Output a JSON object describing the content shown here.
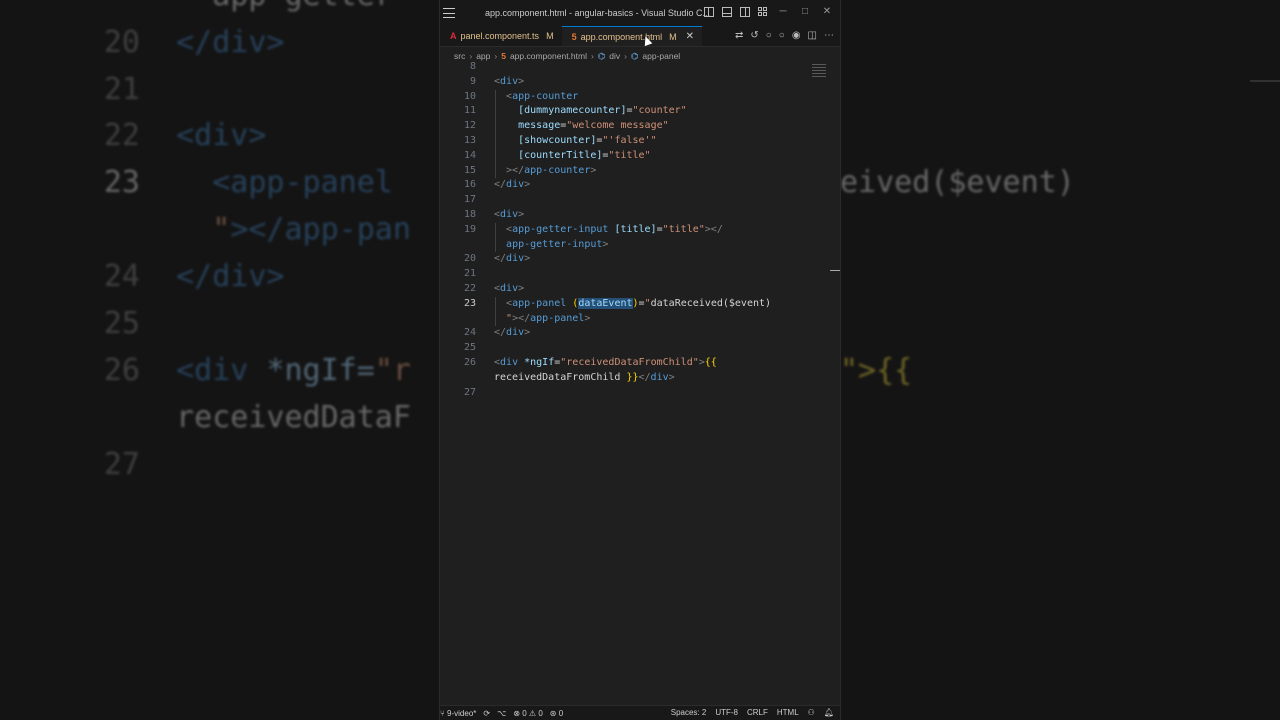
{
  "background": {
    "lines": [
      {
        "num": "",
        "segments": [
          {
            "cls": "bg-txt",
            "text": "  app-getter-"
          }
        ]
      },
      {
        "num": "20",
        "segments": [
          {
            "cls": "bg-tag",
            "text": "</div>"
          }
        ]
      },
      {
        "num": "21",
        "segments": []
      },
      {
        "num": "22",
        "segments": [
          {
            "cls": "bg-tag",
            "text": "<div>"
          }
        ]
      },
      {
        "num": "23",
        "segments": [
          {
            "cls": "bg-tag",
            "text": "  <app-panel"
          }
        ]
      },
      {
        "num": "",
        "segments": [
          {
            "cls": "bg-str",
            "text": "  \""
          },
          {
            "cls": "bg-tag",
            "text": "></app-pan"
          }
        ]
      },
      {
        "num": "24",
        "segments": [
          {
            "cls": "bg-tag",
            "text": "</div>"
          }
        ]
      },
      {
        "num": "25",
        "segments": []
      },
      {
        "num": "26",
        "segments": [
          {
            "cls": "bg-tag",
            "text": "<div "
          },
          {
            "cls": "bg-attr",
            "text": "*ngIf="
          },
          {
            "cls": "bg-str",
            "text": "\"r"
          }
        ]
      },
      {
        "num": "",
        "segments": [
          {
            "cls": "bg-txt",
            "text": "receivedDataF"
          }
        ]
      },
      {
        "num": "27",
        "segments": []
      }
    ],
    "right_fragments": [
      {
        "text": "eived($event)"
      },
      {
        "text": "\">{{"
      }
    ]
  },
  "window": {
    "title": "app.component.html - angular-basics - Visual Studio C...",
    "controls": {
      "minimize": "─",
      "maximize": "□",
      "close": "✕"
    }
  },
  "tabs": [
    {
      "label": "panel.component.ts",
      "modified": "M",
      "icon": "angular-icon",
      "active": false
    },
    {
      "label": "app.component.html",
      "modified": "M",
      "icon": "html-icon",
      "active": true,
      "close": "✕"
    }
  ],
  "breadcrumb": {
    "items": [
      "src",
      "app",
      "app.component.html",
      "div",
      "app-panel"
    ]
  },
  "editor": {
    "current_line": "23",
    "lines": [
      {
        "num": "8",
        "tokens": []
      },
      {
        "num": "9",
        "tokens": [
          {
            "c": "t-br",
            "t": "<"
          },
          {
            "c": "t-tag",
            "t": "div"
          },
          {
            "c": "t-br",
            "t": ">"
          }
        ]
      },
      {
        "num": "10",
        "tokens": [
          {
            "c": "t-txt",
            "t": "  "
          },
          {
            "c": "t-br",
            "t": "<"
          },
          {
            "c": "t-tag",
            "t": "app-counter"
          }
        ]
      },
      {
        "num": "11",
        "tokens": [
          {
            "c": "t-txt",
            "t": "    "
          },
          {
            "c": "t-attr",
            "t": "[dummynamecounter]"
          },
          {
            "c": "t-txt",
            "t": "="
          },
          {
            "c": "t-str",
            "t": "\"counter\""
          }
        ]
      },
      {
        "num": "12",
        "tokens": [
          {
            "c": "t-txt",
            "t": "    "
          },
          {
            "c": "t-attr",
            "t": "message"
          },
          {
            "c": "t-txt",
            "t": "="
          },
          {
            "c": "t-str",
            "t": "\"welcome message\""
          }
        ]
      },
      {
        "num": "13",
        "tokens": [
          {
            "c": "t-txt",
            "t": "    "
          },
          {
            "c": "t-attr",
            "t": "[showcounter]"
          },
          {
            "c": "t-txt",
            "t": "="
          },
          {
            "c": "t-str",
            "t": "\"'false'\""
          }
        ]
      },
      {
        "num": "14",
        "tokens": [
          {
            "c": "t-txt",
            "t": "    "
          },
          {
            "c": "t-attr",
            "t": "[counterTitle]"
          },
          {
            "c": "t-txt",
            "t": "="
          },
          {
            "c": "t-str",
            "t": "\"title\""
          }
        ]
      },
      {
        "num": "15",
        "tokens": [
          {
            "c": "t-txt",
            "t": "  "
          },
          {
            "c": "t-br",
            "t": "></"
          },
          {
            "c": "t-tag",
            "t": "app-counter"
          },
          {
            "c": "t-br",
            "t": ">"
          }
        ]
      },
      {
        "num": "16",
        "tokens": [
          {
            "c": "t-br",
            "t": "</"
          },
          {
            "c": "t-tag",
            "t": "div"
          },
          {
            "c": "t-br",
            "t": ">"
          }
        ]
      },
      {
        "num": "17",
        "tokens": []
      },
      {
        "num": "18",
        "tokens": [
          {
            "c": "t-br",
            "t": "<"
          },
          {
            "c": "t-tag",
            "t": "div"
          },
          {
            "c": "t-br",
            "t": ">"
          }
        ]
      },
      {
        "num": "19",
        "tokens": [
          {
            "c": "t-txt",
            "t": "  "
          },
          {
            "c": "t-br",
            "t": "<"
          },
          {
            "c": "t-tag",
            "t": "app-getter-input"
          },
          {
            "c": "t-txt",
            "t": " "
          },
          {
            "c": "t-attr",
            "t": "[title]"
          },
          {
            "c": "t-txt",
            "t": "="
          },
          {
            "c": "t-str",
            "t": "\"title\""
          },
          {
            "c": "t-br",
            "t": "></"
          }
        ]
      },
      {
        "num": "",
        "tokens": [
          {
            "c": "t-txt",
            "t": "  "
          },
          {
            "c": "t-tag",
            "t": "app-getter-input"
          },
          {
            "c": "t-br",
            "t": ">"
          }
        ]
      },
      {
        "num": "20",
        "tokens": [
          {
            "c": "t-br",
            "t": "</"
          },
          {
            "c": "t-tag",
            "t": "div"
          },
          {
            "c": "t-br",
            "t": ">"
          }
        ]
      },
      {
        "num": "21",
        "tokens": []
      },
      {
        "num": "22",
        "tokens": [
          {
            "c": "t-br",
            "t": "<"
          },
          {
            "c": "t-tag",
            "t": "div"
          },
          {
            "c": "t-br",
            "t": ">"
          }
        ]
      },
      {
        "num": "23",
        "tokens": [
          {
            "c": "t-txt",
            "t": "  "
          },
          {
            "c": "t-br",
            "t": "<"
          },
          {
            "c": "t-tag",
            "t": "app-panel"
          },
          {
            "c": "t-txt",
            "t": " "
          },
          {
            "c": "t-yel",
            "t": "("
          },
          {
            "c": "t-sel",
            "t": "dataEvent"
          },
          {
            "c": "t-yel",
            "t": ")"
          },
          {
            "c": "t-txt",
            "t": "="
          },
          {
            "c": "t-str",
            "t": "\""
          },
          {
            "c": "t-txt",
            "t": "dataReceived($event)"
          }
        ]
      },
      {
        "num": "",
        "tokens": [
          {
            "c": "t-txt",
            "t": "  "
          },
          {
            "c": "t-str",
            "t": "\""
          },
          {
            "c": "t-br",
            "t": "></"
          },
          {
            "c": "t-tag",
            "t": "app-panel"
          },
          {
            "c": "t-br",
            "t": ">"
          }
        ]
      },
      {
        "num": "24",
        "tokens": [
          {
            "c": "t-br",
            "t": "</"
          },
          {
            "c": "t-tag",
            "t": "div"
          },
          {
            "c": "t-br",
            "t": ">"
          }
        ]
      },
      {
        "num": "25",
        "tokens": []
      },
      {
        "num": "26",
        "tokens": [
          {
            "c": "t-br",
            "t": "<"
          },
          {
            "c": "t-tag",
            "t": "div"
          },
          {
            "c": "t-txt",
            "t": " "
          },
          {
            "c": "t-attr",
            "t": "*ngIf"
          },
          {
            "c": "t-txt",
            "t": "="
          },
          {
            "c": "t-str",
            "t": "\"receivedDataFromChild\""
          },
          {
            "c": "t-br",
            "t": ">"
          },
          {
            "c": "t-yel",
            "t": "{{"
          }
        ]
      },
      {
        "num": "",
        "tokens": [
          {
            "c": "t-txt",
            "t": "receivedDataFromChild "
          },
          {
            "c": "t-yel",
            "t": "}}"
          },
          {
            "c": "t-br",
            "t": "</"
          },
          {
            "c": "t-tag",
            "t": "div"
          },
          {
            "c": "t-br",
            "t": ">"
          }
        ]
      },
      {
        "num": "27",
        "tokens": []
      }
    ]
  },
  "statusbar": {
    "branch": "9-video*",
    "errors": "0",
    "warnings": "0",
    "ports": "0",
    "spaces": "Spaces: 2",
    "encoding": "UTF-8",
    "eol": "CRLF",
    "language": "HTML"
  },
  "colors": {
    "accent": "#0078d4",
    "modified": "#e2c08d",
    "tag": "#569cd6",
    "attr": "#9cdcfe",
    "string": "#ce9178"
  }
}
